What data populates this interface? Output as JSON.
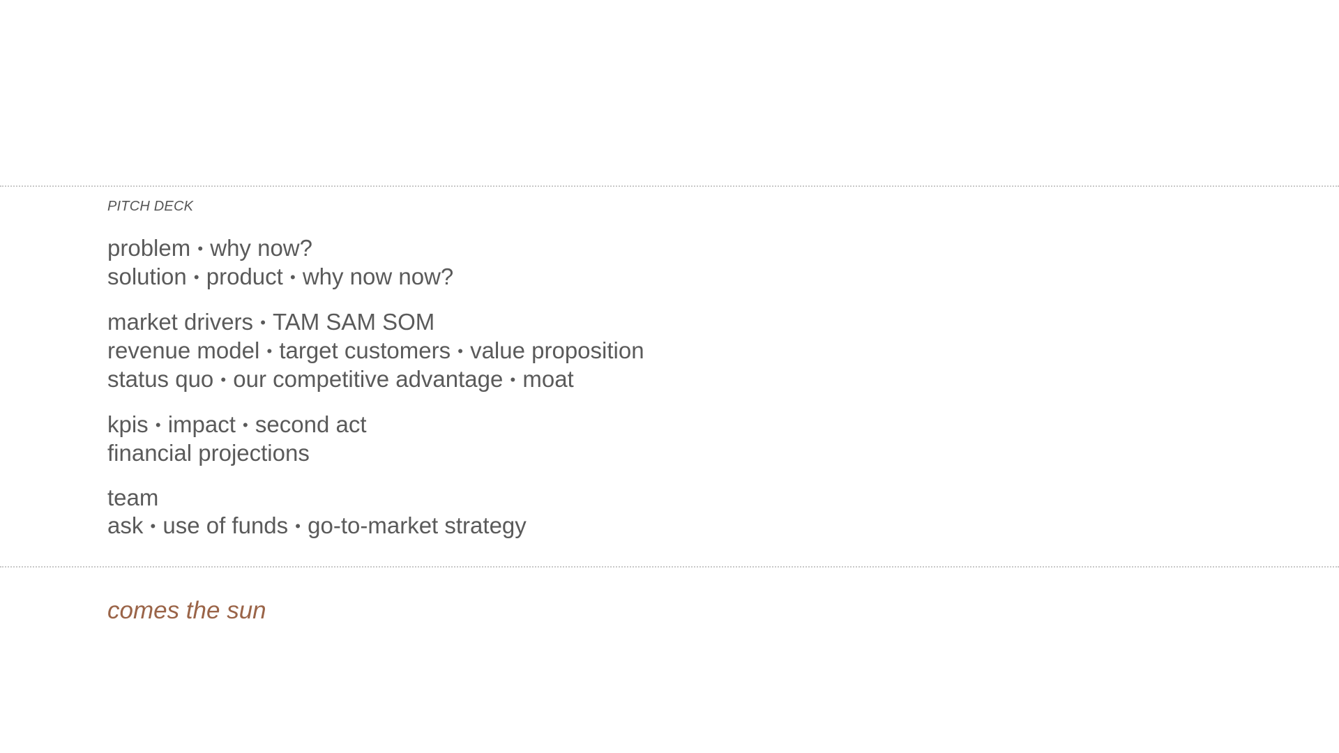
{
  "label": "PITCH DECK",
  "groups": [
    {
      "lines": [
        [
          "problem",
          "why now?"
        ],
        [
          "solution",
          "product",
          "why now now?"
        ]
      ]
    },
    {
      "lines": [
        [
          "market drivers",
          "TAM SAM SOM"
        ],
        [
          "revenue model",
          "target customers",
          "value proposition"
        ],
        [
          "status quo",
          "our competitive advantage",
          "moat"
        ]
      ]
    },
    {
      "lines": [
        [
          "kpis",
          "impact",
          "second act"
        ],
        [
          "financial projections"
        ]
      ]
    },
    {
      "lines": [
        [
          "team"
        ],
        [
          "ask",
          "use of funds",
          "go-to-market strategy"
        ]
      ]
    }
  ],
  "separator": "•",
  "tagline": "comes the sun",
  "colors": {
    "text": "#5a5a5a",
    "tagline": "#9a6448",
    "rule": "#c8c8c8"
  }
}
